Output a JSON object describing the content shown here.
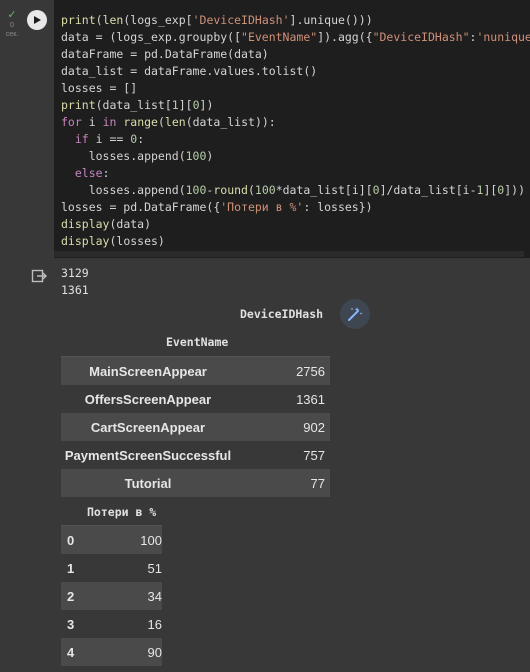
{
  "cell": {
    "status_check": "✓",
    "status_time": "0",
    "status_unit": "сек.",
    "code_lines": [
      "print(len(logs_exp['DeviceIDHash'].unique()))",
      "data = (logs_exp.groupby([\"EventName\"]).agg({\"DeviceIDHash\":'nunique'}",
      "dataFrame = pd.DataFrame(data)",
      "data_list = dataFrame.values.tolist()",
      "losses = []",
      "print(data_list[1][0])",
      "for i in range(len(data_list)):",
      "  if i == 0:",
      "    losses.append(100)",
      "  else:",
      "    losses.append(100-round(100*data_list[i][0]/data_list[i-1][0]))",
      "losses = pd.DataFrame({'Потери в %': losses})",
      "display(data)",
      "display(losses)"
    ]
  },
  "output": {
    "stdout": [
      "3129",
      "1361"
    ],
    "table1": {
      "column_header": "DeviceIDHash",
      "index_header": "EventName",
      "rows": [
        {
          "index": "MainScreenAppear",
          "value": "2756"
        },
        {
          "index": "OffersScreenAppear",
          "value": "1361"
        },
        {
          "index": "CartScreenAppear",
          "value": "902"
        },
        {
          "index": "PaymentScreenSuccessful",
          "value": "757"
        },
        {
          "index": "Tutorial",
          "value": "77"
        }
      ]
    },
    "table2": {
      "column_header": "Потери в %",
      "rows": [
        {
          "index": "0",
          "value": "100"
        },
        {
          "index": "1",
          "value": "51"
        },
        {
          "index": "2",
          "value": "34"
        },
        {
          "index": "3",
          "value": "16"
        },
        {
          "index": "4",
          "value": "90"
        }
      ]
    }
  },
  "icons": {
    "run": "play-icon",
    "output": "output-icon",
    "magic": "magic-wand-icon"
  },
  "colors": {
    "background": "#383838",
    "code_background": "#1e1e1e",
    "keyword": "#c586c0",
    "string": "#ce9178",
    "function": "#dcdcaa",
    "number": "#b5cea8",
    "status_ok": "#5fb85f"
  }
}
